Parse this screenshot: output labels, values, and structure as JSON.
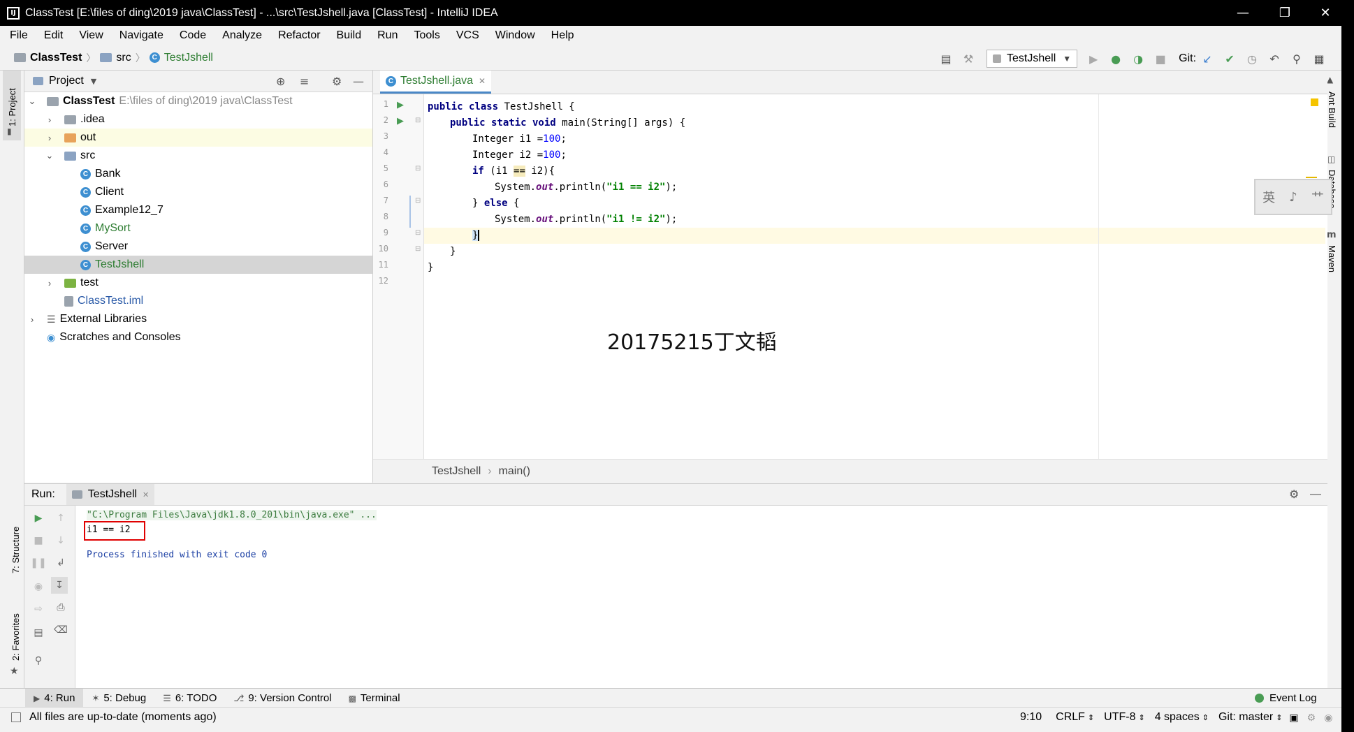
{
  "window": {
    "title": "ClassTest [E:\\files of ding\\2019 java\\ClassTest] - ...\\src\\TestJshell.java [ClassTest] - IntelliJ IDEA",
    "app_icon_label": "IJ"
  },
  "menu": [
    "File",
    "Edit",
    "View",
    "Navigate",
    "Code",
    "Analyze",
    "Refactor",
    "Build",
    "Run",
    "Tools",
    "VCS",
    "Window",
    "Help"
  ],
  "breadcrumb": {
    "project": "ClassTest",
    "folder": "src",
    "file": "TestJshell"
  },
  "toolbar": {
    "run_config": "TestJshell",
    "git_label": "Git:"
  },
  "left_strip": {
    "project": "1: Project",
    "structure": "7: Structure",
    "favorites": "2: Favorites"
  },
  "right_strip": {
    "ant": "Ant Build",
    "database": "Database",
    "maven": "Maven"
  },
  "project_panel": {
    "title": "Project",
    "root_name": "ClassTest",
    "root_path": "E:\\files of ding\\2019 java\\ClassTest",
    "items": [
      {
        "label": ".idea"
      },
      {
        "label": "out"
      },
      {
        "label": "src"
      },
      {
        "label": "Bank"
      },
      {
        "label": "Client"
      },
      {
        "label": "Example12_7"
      },
      {
        "label": "MySort"
      },
      {
        "label": "Server"
      },
      {
        "label": "TestJshell"
      },
      {
        "label": "test"
      },
      {
        "label": "ClassTest.iml"
      },
      {
        "label": "External Libraries"
      },
      {
        "label": "Scratches and Consoles"
      }
    ]
  },
  "editor": {
    "tab": "TestJshell.java",
    "line_numbers": [
      "1",
      "2",
      "3",
      "4",
      "5",
      "6",
      "7",
      "8",
      "9",
      "10",
      "11",
      "12"
    ],
    "code": {
      "l1_kw": "public class",
      "l1_rest": " TestJshell {",
      "l2_kw": "public static void",
      "l2_rest": " main(String[] args) {",
      "l3_a": "Integer i1 =",
      "l3_num": "100",
      "l3_b": ";",
      "l4_a": "Integer i2 =",
      "l4_num": "100",
      "l4_b": ";",
      "l5_kw": "if",
      "l5_a": " (i1 ",
      "l5_op": "==",
      "l5_b": " i2){",
      "l6_a": "System.",
      "l6_fld": "out",
      "l6_b": ".println(",
      "l6_str": "\"i1 == i2\"",
      "l6_c": ");",
      "l7_a": "} ",
      "l7_kw": "else",
      "l7_b": " {",
      "l8_a": "System.",
      "l8_fld": "out",
      "l8_b": ".println(",
      "l8_str": "\"i1 != i2\"",
      "l8_c": ");",
      "l9": "}",
      "l10": "}",
      "l11": "}"
    },
    "watermark": "20175215丁文韬",
    "crumb_class": "TestJshell",
    "crumb_method": "main()"
  },
  "run_panel": {
    "label": "Run:",
    "tab": "TestJshell",
    "command": "\"C:\\Program Files\\Java\\jdk1.8.0_201\\bin\\java.exe\" ...",
    "output": "i1 == i2",
    "exit": "Process finished with exit code 0"
  },
  "bottom_tabs": [
    "4: Run",
    "5: Debug",
    "6: TODO",
    "9: Version Control",
    "Terminal"
  ],
  "event_log": "Event Log",
  "ime": [
    "英",
    "♪",
    "⺾"
  ],
  "status": {
    "message": "All files are up-to-date (moments ago)",
    "position": "9:10",
    "line_sep": "CRLF",
    "encoding": "UTF-8",
    "indent": "4 spaces",
    "git": "Git: master"
  },
  "colors": {
    "accent": "#4a88c7",
    "current_line": "#fffae3",
    "run_green": "#499c54"
  }
}
